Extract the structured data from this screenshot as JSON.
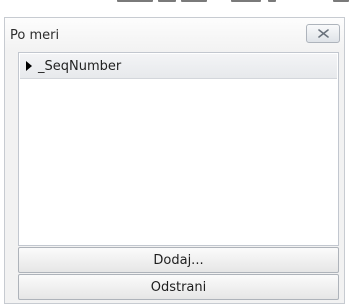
{
  "panel": {
    "title": "Po meri",
    "close_icon": "close-x-icon"
  },
  "list": {
    "items": [
      {
        "label": "_SeqNumber",
        "icon": "expand-arrow-icon"
      }
    ]
  },
  "buttons": {
    "add_label": "Dodaj...",
    "remove_label": "Odstrani"
  }
}
